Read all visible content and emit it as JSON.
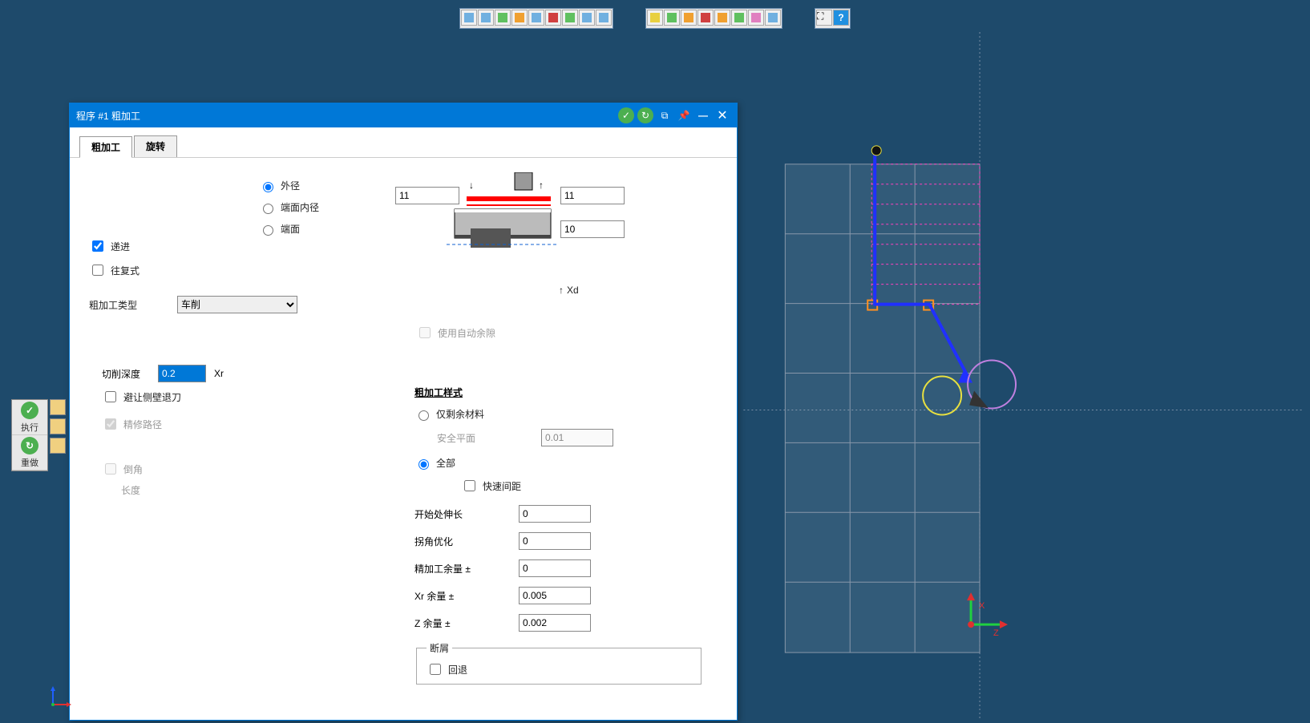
{
  "dialog": {
    "title": "程序 #1 粗加工",
    "tabs": {
      "roughing": "粗加工",
      "rotate": "旋转"
    },
    "feedMode": {
      "progressive": "递进",
      "reciprocating": "往复式"
    },
    "radiusMode": {
      "outer": "外径",
      "faceInner": "端面内径",
      "face": "端面"
    },
    "topInputs": {
      "v1": "11",
      "v2": "11",
      "v3": "10"
    },
    "xdLabel": "Xd",
    "roughTypeLabel": "粗加工类型",
    "roughTypeValue": "车削",
    "useAutoClear": "使用自动余隙",
    "cutDepthLabel": "切削深度",
    "cutDepthValue": "0.2",
    "cutDepthUnit": "Xr",
    "avoidWall": "避让侧壁退刀",
    "finishPath": "精修路径",
    "chamfer": "倒角",
    "lengthLabel": "长度",
    "styleTitle": "粗加工样式",
    "styleRemain": "仅剩余材料",
    "styleAll": "全部",
    "safePlaneLabel": "安全平面",
    "safePlaneValue": "0.01",
    "fastGap": "快速间距",
    "startExtLabel": "开始处伸长",
    "startExtValue": "0",
    "cornerOptLabel": "拐角优化",
    "cornerOptValue": "0",
    "finishAllowLabel": "精加工余量 ±",
    "finishAllowValue": "0",
    "xrAllowLabel": "Xr 余量 ±",
    "xrAllowValue": "0.005",
    "zAllowLabel": "Z 余量 ±",
    "zAllowValue": "0.002",
    "chipBreak": "断屑",
    "retract": "回退"
  },
  "sideToolbar": {
    "run": "执行",
    "redo": "重做"
  }
}
